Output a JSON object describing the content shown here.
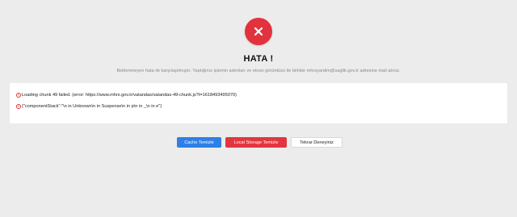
{
  "error": {
    "icon": "close-icon",
    "title": "HATA !",
    "subtitle": "Beklenmeyen hata ile karşılaşılmıştır. Yaptığınız işlemin adımları ve ekran görüntüsü ile birlikte mhrsyardim@saglik.gov.tr adresine mail atınız.",
    "lines": [
      "Loading chunk 49 failed. (error: https://www.mhrs.gov.tr/vatandas/vatandas-49-chunk.js?t=1618493495070)",
      "{\"componentStack\":\"\\n in Unknown\\n in Suspense\\n in p\\n in _\\n in e\"}"
    ]
  },
  "buttons": {
    "cache": "Cache Temizle",
    "local_storage": "Local Storage Temizle",
    "retry": "Tekrar Deneyiniz"
  },
  "colors": {
    "accent_red": "#e2323d",
    "accent_blue": "#2f7fe6",
    "background": "#ececec"
  }
}
